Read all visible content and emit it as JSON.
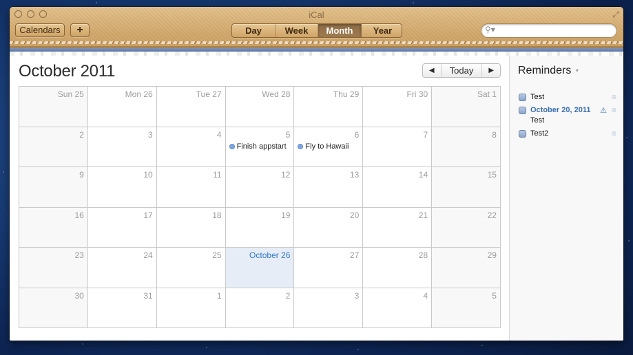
{
  "window": {
    "title": "iCal",
    "traffic_lights": [
      "close",
      "minimize",
      "zoom"
    ],
    "fullscreen_icon": "⤢"
  },
  "toolbar": {
    "calendars_label": "Calendars",
    "add_label": "+",
    "views": [
      {
        "label": "Day",
        "active": false
      },
      {
        "label": "Week",
        "active": false
      },
      {
        "label": "Month",
        "active": true
      },
      {
        "label": "Year",
        "active": false
      }
    ],
    "search": {
      "value": "",
      "placeholder": "",
      "icon": "⚲▾"
    }
  },
  "main": {
    "month_title": "October 2011",
    "nav": {
      "prev": "◀",
      "today": "Today",
      "next": "▶"
    },
    "weeks": [
      [
        {
          "num": "Sun 25"
        },
        {
          "num": "Mon 26"
        },
        {
          "num": "Tue 27"
        },
        {
          "num": "Wed 28"
        },
        {
          "num": "Thu 29"
        },
        {
          "num": "Fri 30"
        },
        {
          "num": "Sat 1"
        }
      ],
      [
        {
          "num": "2"
        },
        {
          "num": "3"
        },
        {
          "num": "4"
        },
        {
          "num": "5",
          "event": "Finish appstart"
        },
        {
          "num": "6",
          "event": "Fly to Hawaii"
        },
        {
          "num": "7"
        },
        {
          "num": "8"
        }
      ],
      [
        {
          "num": "9"
        },
        {
          "num": "10"
        },
        {
          "num": "11"
        },
        {
          "num": "12"
        },
        {
          "num": "13"
        },
        {
          "num": "14"
        },
        {
          "num": "15"
        }
      ],
      [
        {
          "num": "16"
        },
        {
          "num": "17"
        },
        {
          "num": "18"
        },
        {
          "num": "19"
        },
        {
          "num": "20"
        },
        {
          "num": "21"
        },
        {
          "num": "22"
        }
      ],
      [
        {
          "num": "23"
        },
        {
          "num": "24"
        },
        {
          "num": "25"
        },
        {
          "num": "October 26",
          "today": true
        },
        {
          "num": "27"
        },
        {
          "num": "28"
        },
        {
          "num": "29"
        }
      ],
      [
        {
          "num": "30"
        },
        {
          "num": "31"
        },
        {
          "num": "1"
        },
        {
          "num": "2"
        },
        {
          "num": "3"
        },
        {
          "num": "4"
        },
        {
          "num": "5"
        }
      ]
    ]
  },
  "reminders": {
    "title": "Reminders",
    "caret": "▾",
    "items": [
      {
        "text": "Test"
      },
      {
        "date": "October 20, 2011",
        "text": "Test",
        "alert": "⚠"
      },
      {
        "text": "Test2"
      }
    ],
    "handle_glyph": "≡"
  },
  "colors": {
    "today_bg": "#e6edf7",
    "today_text": "#3478c6",
    "event_dot": "#7fa7e2",
    "reminder_date": "#3a6fb0"
  }
}
